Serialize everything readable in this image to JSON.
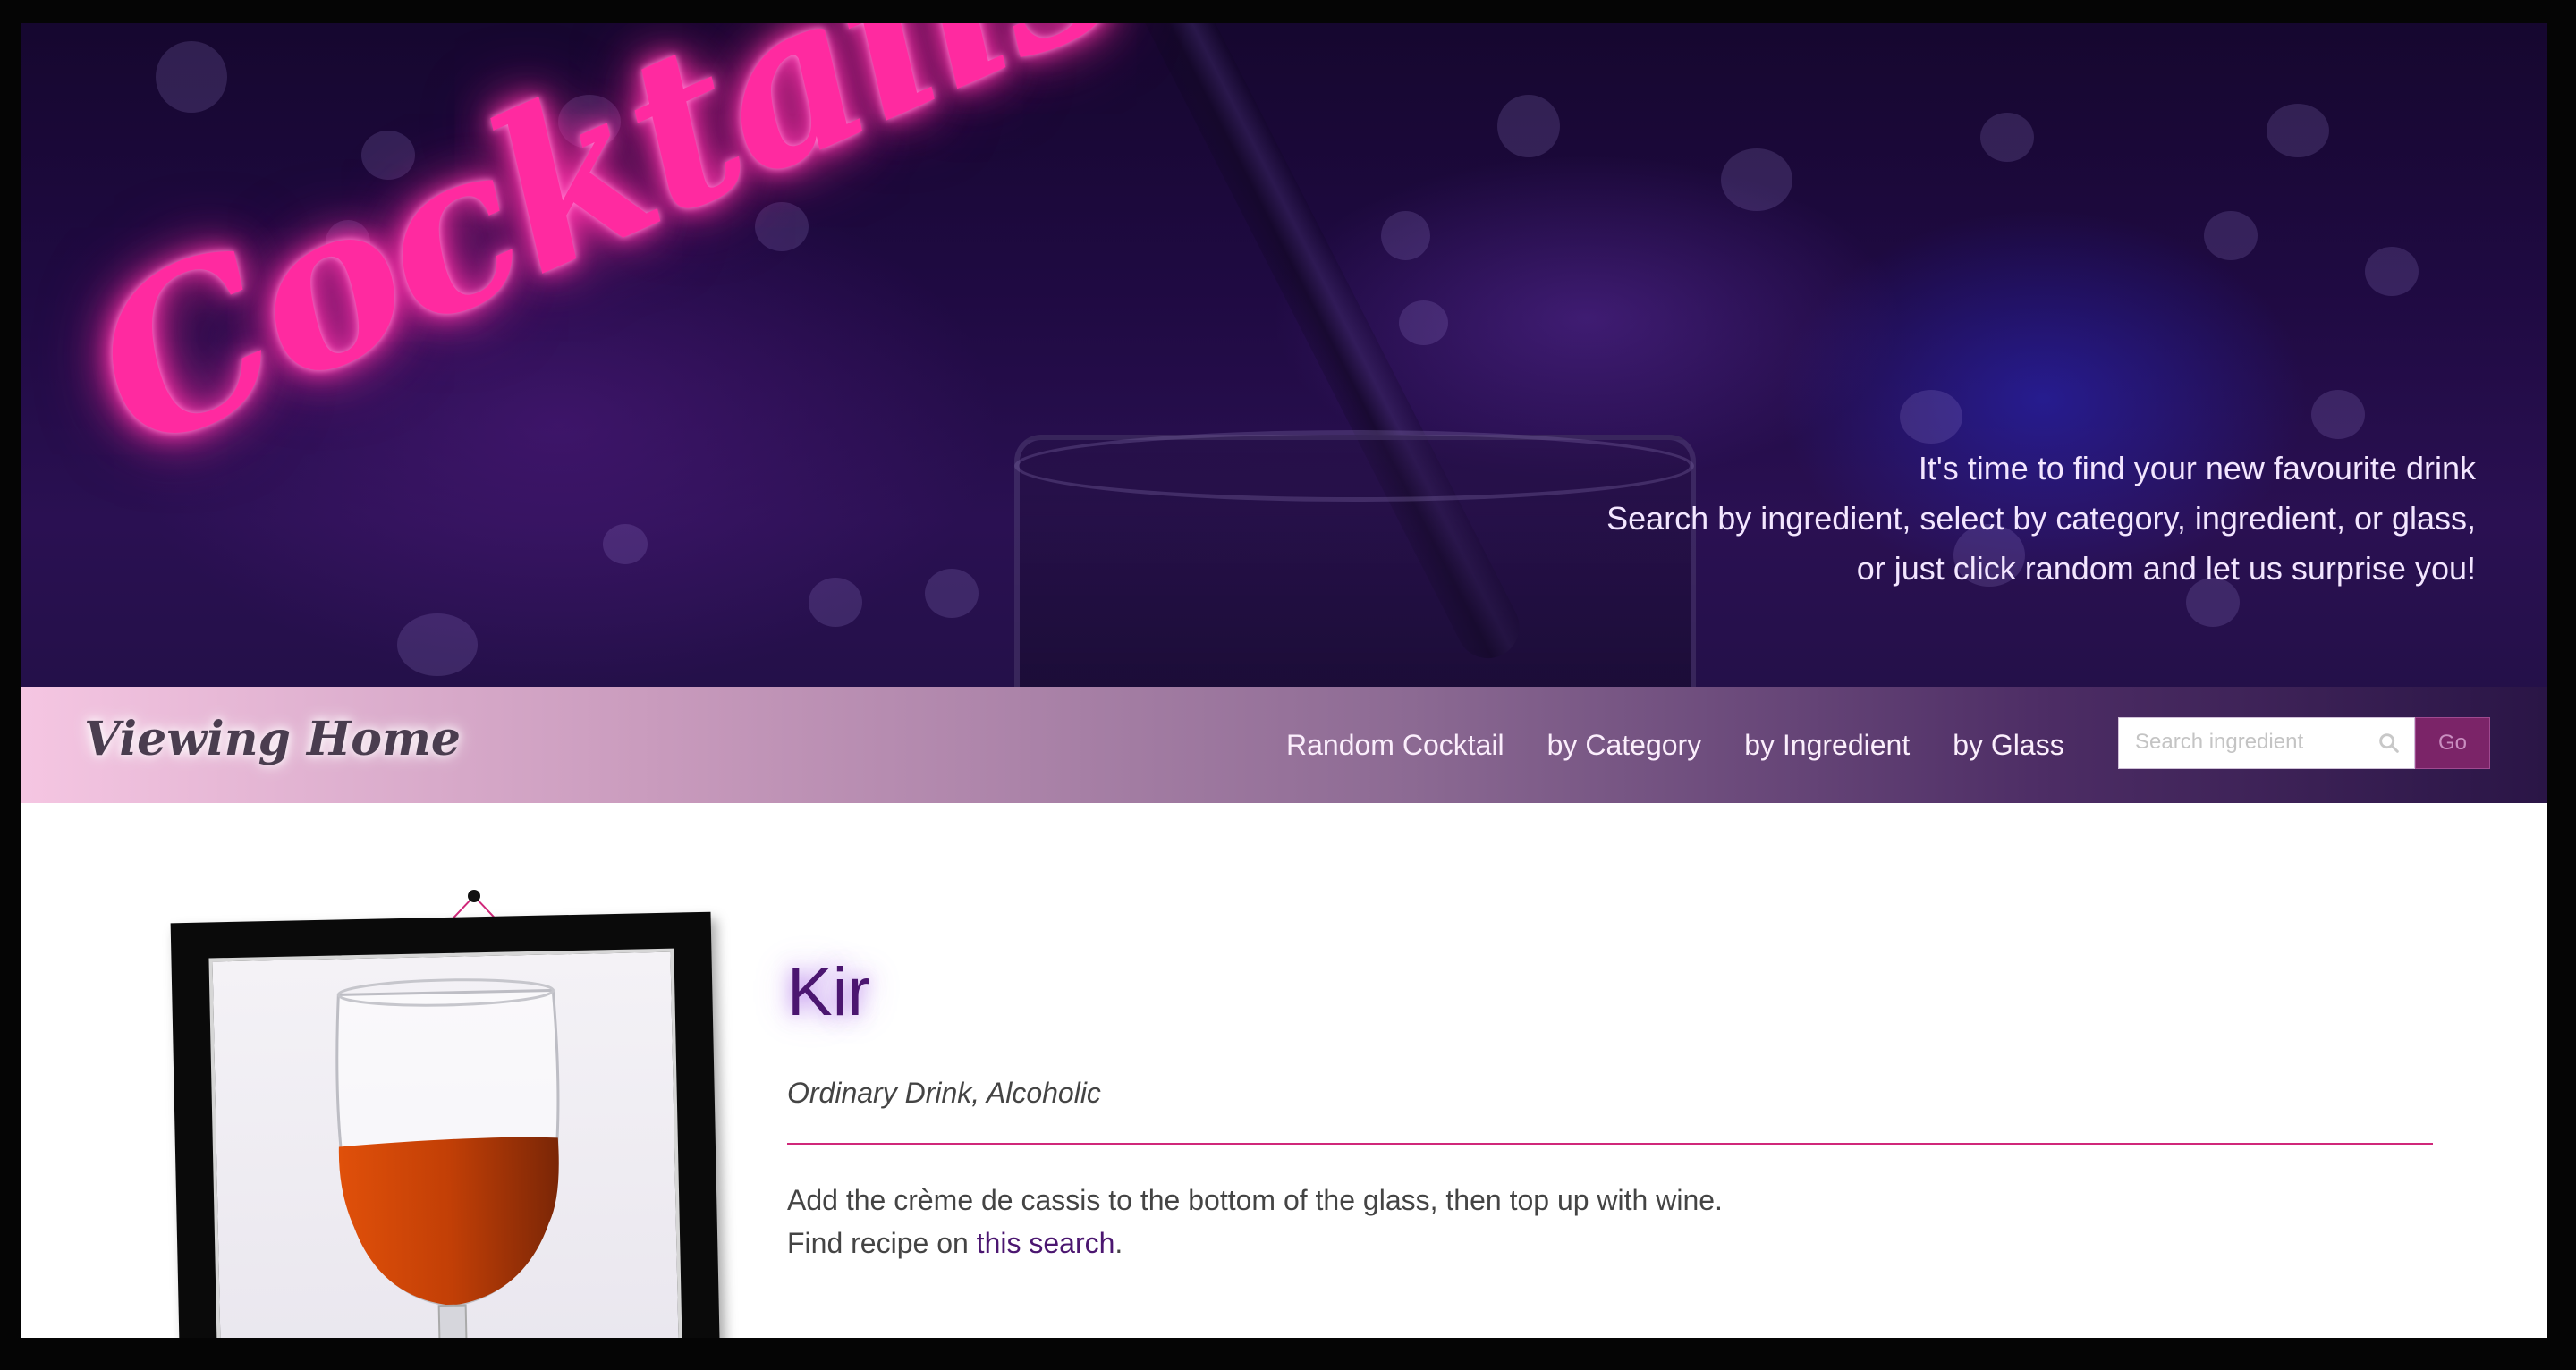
{
  "hero": {
    "title": "Cocktails",
    "tagline_1": "It's time to find your new favourite drink",
    "tagline_2": "Search by ingredient, select by category, ingredient, or glass,",
    "tagline_3": "or just click random and let us surprise you!"
  },
  "nav": {
    "brand": "Viewing Home",
    "links": [
      "Random Cocktail",
      "by Category",
      "by Ingredient",
      "by Glass"
    ],
    "search": {
      "placeholder": "Search ingredient",
      "value": ""
    },
    "go_label": "Go"
  },
  "drink": {
    "name": "Kir",
    "meta": "Ordinary Drink, Alcoholic",
    "instructions": "Add the crème de cassis to the bottom of the glass, then top up with wine.",
    "recipe_prefix": "Find recipe on ",
    "recipe_link": "this search",
    "recipe_suffix": "."
  },
  "colors": {
    "neon_pink": "#ff2aa0",
    "title_purple": "#4b1670",
    "divider": "#d0287a",
    "go_button": "#7b2468"
  }
}
